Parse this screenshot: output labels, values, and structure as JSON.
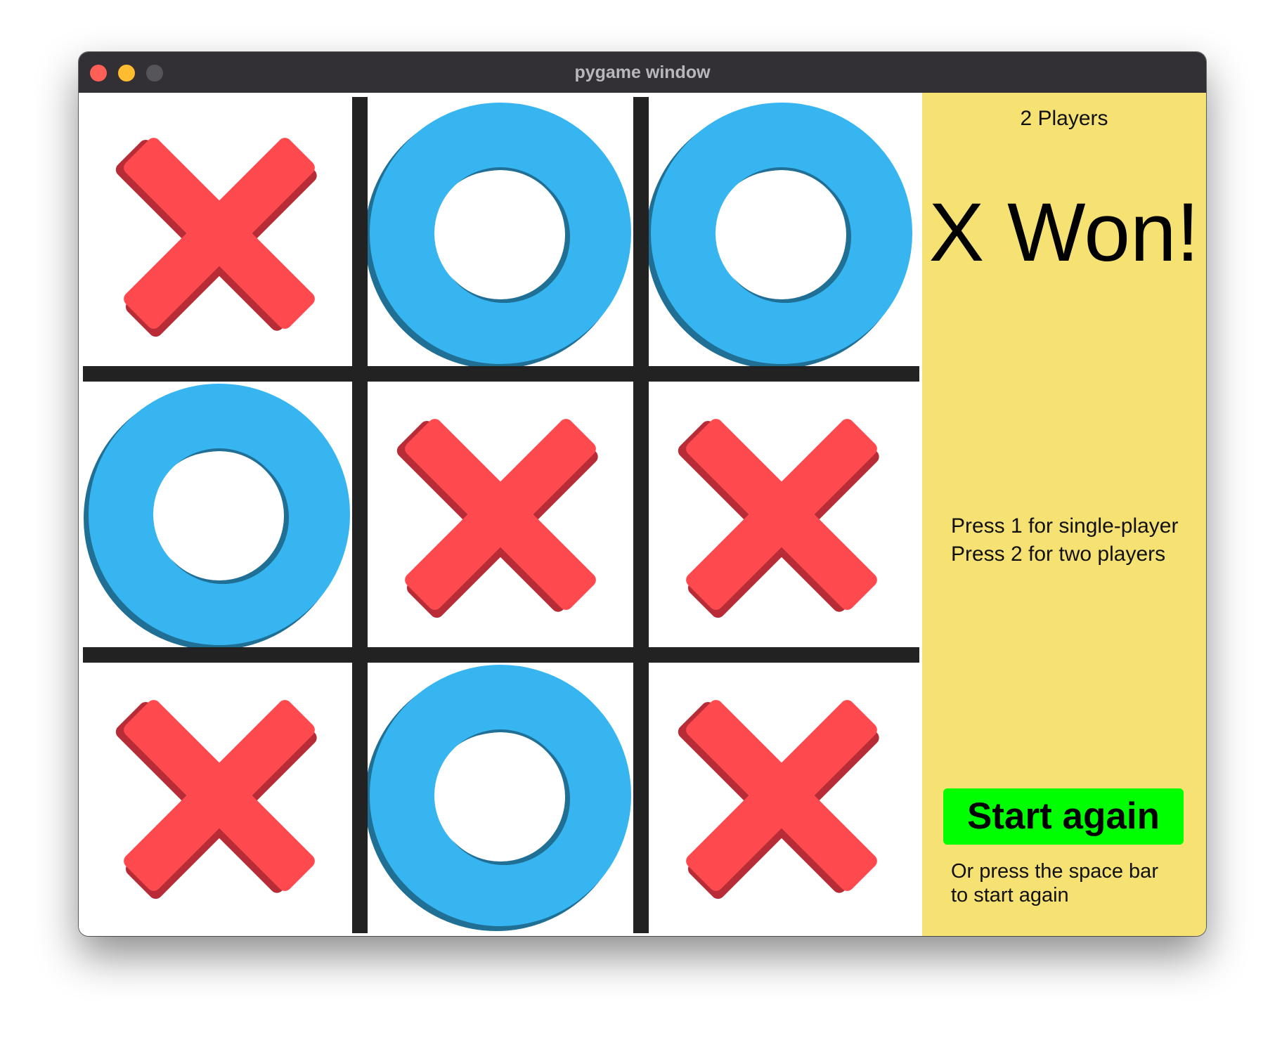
{
  "window": {
    "title": "pygame window"
  },
  "board": {
    "cells": [
      "X",
      "O",
      "O",
      "O",
      "X",
      "X",
      "X",
      "O",
      "X"
    ]
  },
  "panel": {
    "mode_label": "2 Players",
    "result": "X Won!",
    "instructions": [
      "Press 1 for single-player",
      "Press 2 for two players"
    ],
    "start_button_label": "Start again",
    "hint_lines": [
      "Or press the space bar",
      "to start again"
    ]
  },
  "colors": {
    "x_mark": "#fe4a4f",
    "x_shadow": "#b72c36",
    "o_mark": "#37b5f0",
    "o_shadow": "#206f95",
    "grid_line": "#222222",
    "panel_bg": "#f6e173",
    "start_button_bg": "#00ff00"
  }
}
